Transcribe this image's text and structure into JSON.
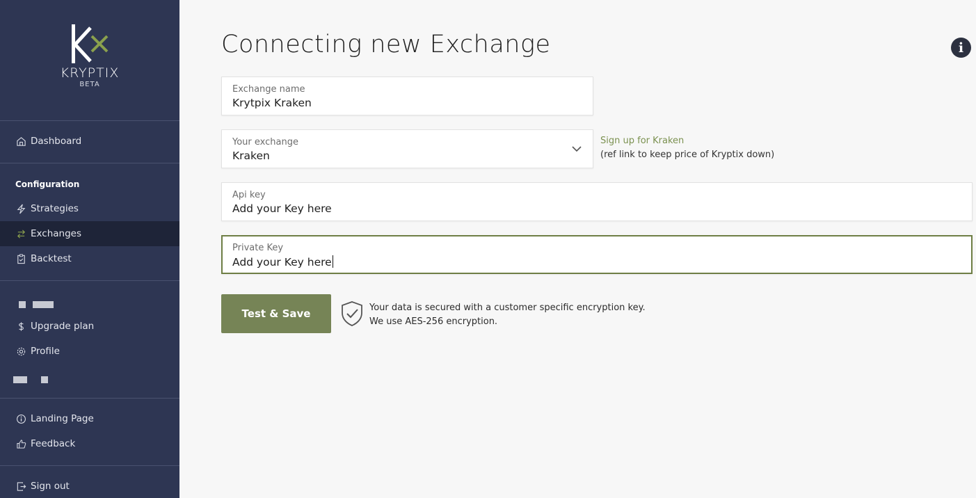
{
  "brand": {
    "name": "KRYPTIX",
    "tag": "BETA"
  },
  "sidebar": {
    "dashboard": "Dashboard",
    "config_title": "Configuration",
    "strategies": "Strategies",
    "exchanges": "Exchanges",
    "backtest": "Backtest",
    "upgrade": "Upgrade plan",
    "profile": "Profile",
    "landing": "Landing Page",
    "feedback": "Feedback",
    "signout": "Sign out"
  },
  "page": {
    "title": "Connecting new Exchange"
  },
  "form": {
    "exchange_name": {
      "label": "Exchange name",
      "value": "Krytpix Kraken"
    },
    "exchange": {
      "label": "Your exchange",
      "value": "Kraken"
    },
    "api_key": {
      "label": "Api key",
      "value": "Add your Key here"
    },
    "private_key": {
      "label": "Private Key",
      "value": "Add your Key here"
    }
  },
  "signup": {
    "link": "Sign up for Kraken",
    "note": "(ref link to keep price of Kryptix down)"
  },
  "actions": {
    "save": "Test & Save"
  },
  "security": {
    "line1": "Your data is secured with a customer specific encryption key.",
    "line2": "We use AES-256 encryption."
  },
  "icons": {
    "info": "info-icon",
    "shield": "shield-check-icon",
    "chevron": "chevron-down-icon"
  },
  "colors": {
    "sidebar": "#2e3653",
    "sidebar_active": "#1e2438",
    "accent": "#768456",
    "link": "#7b9150"
  }
}
